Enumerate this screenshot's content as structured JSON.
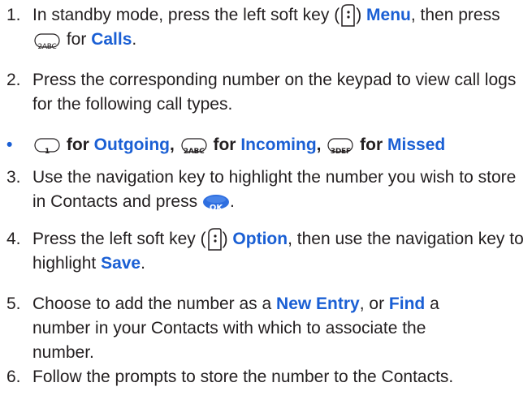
{
  "steps": [
    {
      "num": "1.",
      "t1": "In standby mode, press the left soft key (",
      "t2": ") ",
      "menu": "Menu",
      "t3": ", then press ",
      "key_2abc": "2ABC",
      "t4": " for ",
      "calls": "Calls",
      "t5": "."
    },
    {
      "num": "2.",
      "text": "Press the corresponding number on the keypad to view call logs for the following call types."
    },
    {
      "bullet": "•",
      "key_1": "1",
      "for1": " for ",
      "outgoing": "Outgoing",
      "sep1": ", ",
      "key_2abc": "2ABC",
      "for2": " for ",
      "incoming": "Incoming",
      "sep2": ", ",
      "key_3def": "3DEF",
      "for3": " for ",
      "missed": "Missed"
    },
    {
      "num": "3.",
      "t1": "Use the navigation key to highlight the number you wish to store in Contacts and press ",
      "ok": "OK",
      "t2": "."
    },
    {
      "num": "4.",
      "t1": "Press the left soft key (",
      "t2": ") ",
      "option": "Option",
      "t3": ", then use the navigation key to highlight ",
      "save": "Save",
      "t4": "."
    },
    {
      "num": "5.",
      "t1": "Choose to add the number as a ",
      "new_entry": "New Entry",
      "t2": ", or ",
      "find": "Find",
      "t3": " a number in your Contacts with which to associate the number."
    },
    {
      "num": "6.",
      "text": "Follow the prompts to store the number to the Contacts."
    }
  ],
  "icons": {
    "softkey": "left-soft-key-icon",
    "key_1": "keypad-1-icon",
    "key_2": "keypad-2abc-icon",
    "key_3": "keypad-3def-icon",
    "ok": "ok-key-icon"
  },
  "colors": {
    "keyword": "#1a5fd4",
    "text": "#231f20",
    "ok": "#2f6fe0"
  }
}
